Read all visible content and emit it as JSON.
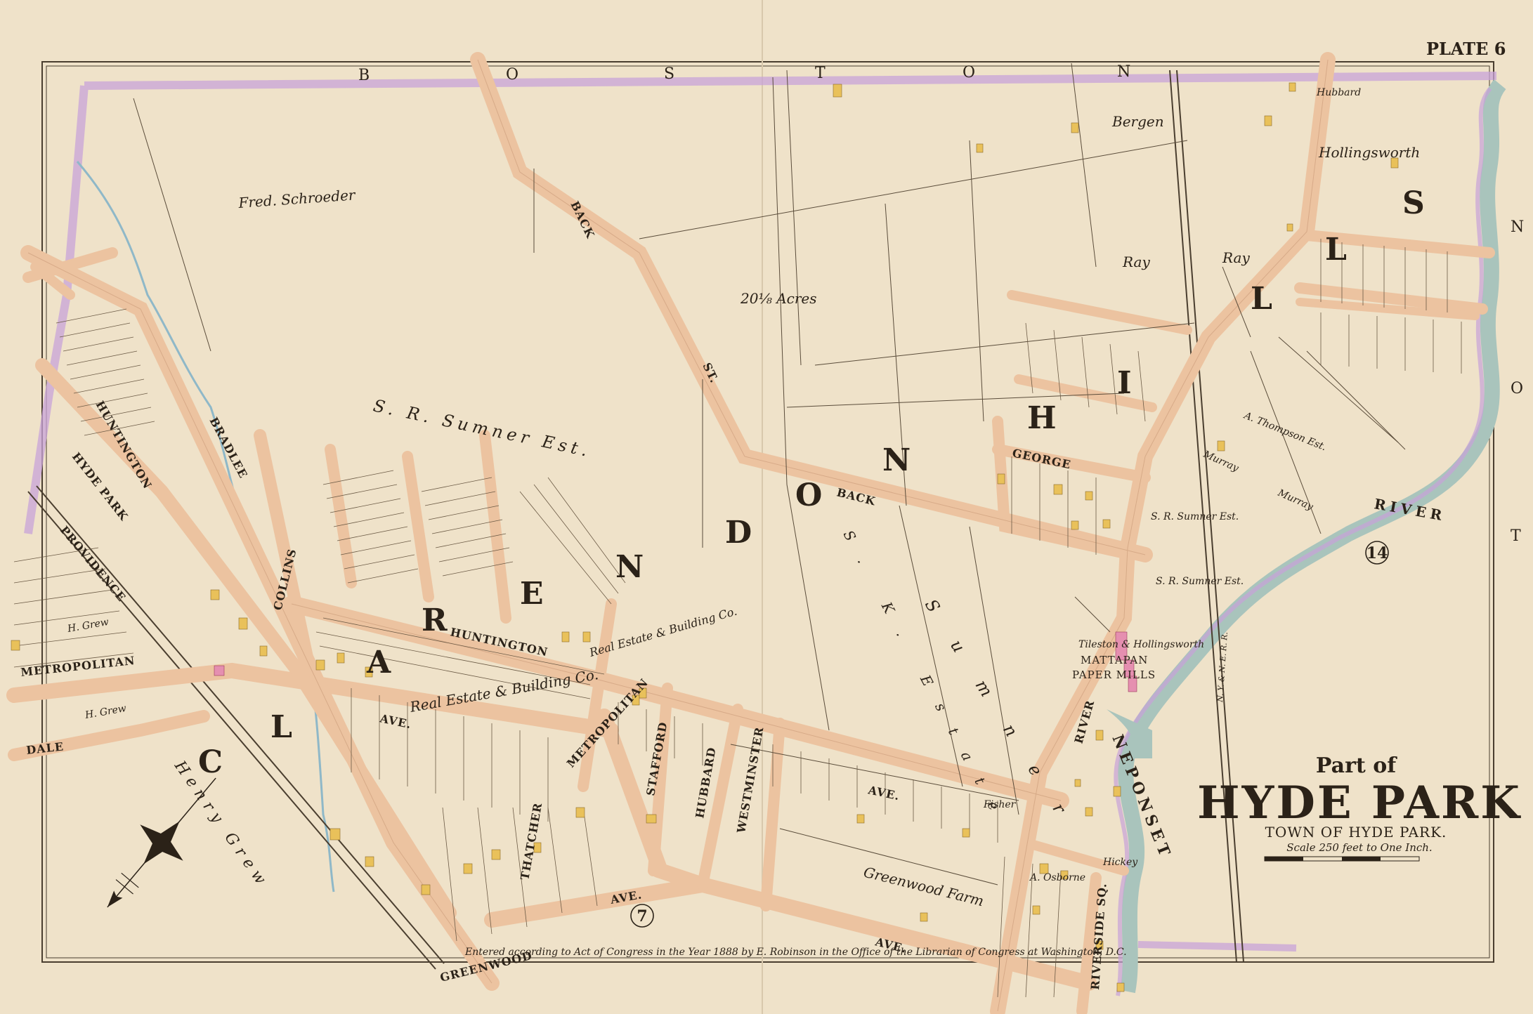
{
  "plate": "PLATE 6",
  "boston_letters": [
    "B",
    "O",
    "S",
    "T",
    "O",
    "N"
  ],
  "boston_right_letters": [
    "N",
    "O",
    "T"
  ],
  "clarendon_letters": [
    "C",
    "L",
    "A",
    "R",
    "E",
    "N",
    "D",
    "O",
    "N"
  ],
  "hills_letters": [
    "H",
    "I",
    "L",
    "L",
    "S"
  ],
  "title": {
    "part_of": "Part of",
    "main": "HYDE PARK",
    "town": "TOWN OF HYDE PARK.",
    "scale": "Scale 250 feet to One Inch."
  },
  "copyright": "Entered according to Act of Congress in the Year 1888 by E. Robinson in the Office of the Librarian of Congress at Washington, D.C.",
  "owners": {
    "schroeder": "Fred. Schroeder",
    "sumner_est": "S. R. Sumner Est.",
    "acres": "20⅛ Acres",
    "bergen": "Bergen",
    "hollingsworth": "Hollingsworth",
    "hubbard": "Hubbard",
    "ray1": "Ray",
    "ray2": "Ray",
    "thompson": "A. Thompson Est.",
    "murray1": "Murray",
    "murray2": "Murray",
    "sumner_est2": "S. R. Sumner Est.",
    "sumner_est3": "S. R. Sumner Est.",
    "sk_estate": "S. K. Estate",
    "sumner_letters": "S u m n e r",
    "mills_owner": "Tileston & Hollingsworth",
    "mattapan": "MATTAPAN",
    "paper_mills": "PAPER MILLS",
    "real_estate1": "Real Estate & Building Co.",
    "real_estate2": "Real Estate & Building Co.",
    "henry_grew": "Henry Grew",
    "h_grew1": "H. Grew",
    "h_grew2": "H. Grew",
    "greenwood_farm": "Greenwood Farm",
    "fisher": "Fisher",
    "hickey": "Hickey",
    "osborne": "A. Osborne"
  },
  "streets": {
    "back1": "BACK",
    "back_st": "ST.",
    "back2": "BACK",
    "huntington1": "HUNTINGTON",
    "huntington2": "HUNTINGTON",
    "hyde_park": "HYDE PARK",
    "providence": "PROVIDENCE",
    "metropolitan1": "METROPOLITAN",
    "metropolitan2": "METROPOLITAN",
    "ave1": "AVE.",
    "ave2": "AVE.",
    "ave3": "AVE.",
    "ave4": "AVE.",
    "dale": "DALE",
    "bradlee": "BRADLEE",
    "collins": "COLLINS",
    "george": "GEORGE",
    "river_st": "RIVER",
    "riverside": "RIVERSIDE SQ.",
    "greenwood": "GREENWOOD",
    "thatcher": "THATCHER",
    "hubbard": "HUBBARD",
    "westminster": "WESTMINSTER",
    "stafford": "STAFFORD",
    "neponset": "NEPONSET",
    "river_label": "RIVER",
    "railroad": "N. Y. & N. E. R. R."
  },
  "circles": [
    "7",
    "14"
  ],
  "colors": {
    "paper": "#efe2c9",
    "road": "#ecc3a0",
    "road_edge": "#c99a78",
    "river": "#a9c4bc",
    "boundary": "#c8a3d8",
    "building": "#e9c15a",
    "building_pink": "#e58fb0",
    "ink": "#2b2218"
  }
}
